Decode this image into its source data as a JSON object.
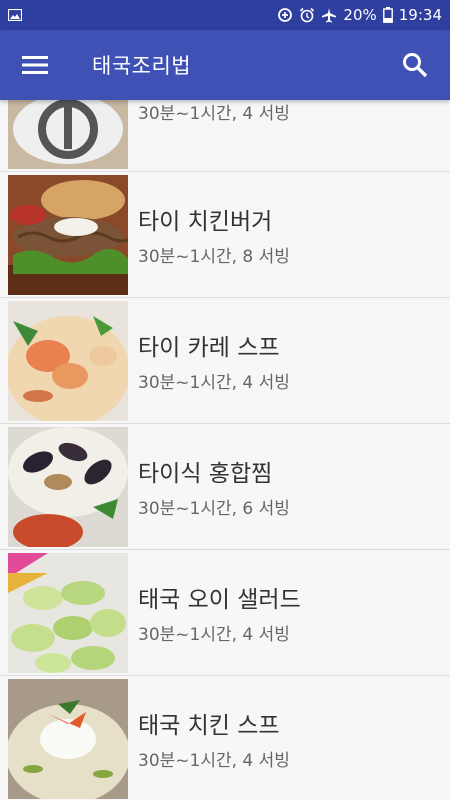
{
  "status_bar": {
    "battery": "20%",
    "time": "19:34",
    "icons": [
      "image-icon",
      "data-saver-icon",
      "alarm-icon",
      "airplane-mode-icon",
      "battery-icon"
    ]
  },
  "app_bar": {
    "title": "태국조리법",
    "menu_icon": "hamburger-menu-icon",
    "search_icon": "search-icon"
  },
  "recipes": [
    {
      "name": "",
      "meta": "30분~1시간, 4 서빙",
      "image": "partially-hidden-dish"
    },
    {
      "name": "타이 치킨버거",
      "meta": "30분~1시간, 8 서빙",
      "image": "chicken-burger"
    },
    {
      "name": "타이 카레 스프",
      "meta": "30분~1시간, 4 서빙",
      "image": "curry-soup"
    },
    {
      "name": "타이식 홍합찜",
      "meta": "30분~1시간, 6 서빙",
      "image": "steamed-mussels"
    },
    {
      "name": "태국 오이 샐러드",
      "meta": "30분~1시간, 4 서빙",
      "image": "cucumber-salad"
    },
    {
      "name": "태국 치킨 스프",
      "meta": "30분~1시간, 4 서빙",
      "image": "chicken-soup"
    }
  ],
  "colors": {
    "app_bar": "#3f51b5",
    "status_bar": "#2f3f9f",
    "background": "#f5f5f5"
  }
}
